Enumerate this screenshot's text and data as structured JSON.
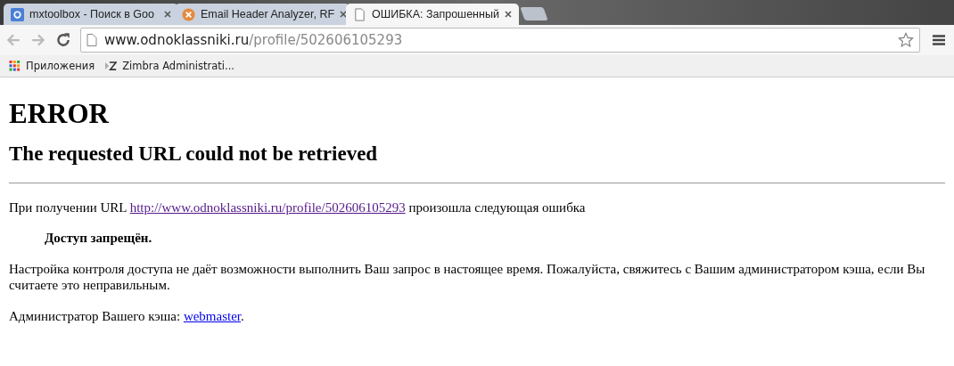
{
  "tabs": [
    {
      "title": "mxtoolbox - Поиск в Goo",
      "selected": false
    },
    {
      "title": "Email Header Analyzer, RF",
      "selected": false
    },
    {
      "title": "ОШИБКА: Запрошенный",
      "selected": true
    }
  ],
  "address_bar": {
    "host": "www.odnoklassniki.ru",
    "path": "/profile/502606105293"
  },
  "bookmarks": [
    {
      "label": "Приложения"
    },
    {
      "label": "Zimbra Administrati..."
    }
  ],
  "page": {
    "heading": "ERROR",
    "subheading": "The requested URL could not be retrieved",
    "intro": {
      "before": "При получении URL ",
      "link": "http://www.odnoklassniki.ru/profile/502606105293",
      "after": " произошла следующая ошибка",
      "link_visited": true
    },
    "error": "Доступ запрещён.",
    "message": "Настройка контроля доступа не даёт возможности выполнить Ваш запрос в настоящее время. Пожалуйста, свяжитесь с Вашим администратором кэша, если Вы считаете это неправильным.",
    "admin": {
      "before": "Администратор Вашего кэша: ",
      "link": "webmaster",
      "after": "."
    }
  }
}
